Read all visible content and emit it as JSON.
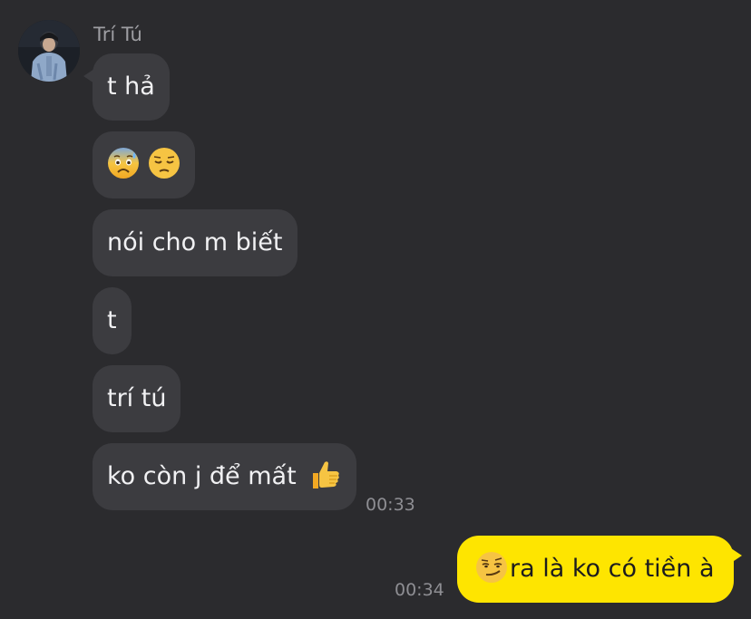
{
  "conversation": {
    "sender_name": "Trí Tú",
    "incoming": [
      {
        "text": "t hả"
      },
      {
        "text": "",
        "emojis": [
          "anxious-face-with-sweat-emoji",
          "pensive-face-emoji"
        ]
      },
      {
        "text": "nói cho m biết"
      },
      {
        "text": "t"
      },
      {
        "text": "trí tú"
      },
      {
        "text": "ko còn j để mất",
        "emojis": [
          "thumbs-up-emoji"
        ]
      }
    ],
    "incoming_time": "00:33",
    "outgoing": {
      "text": "ra là ko có tiền à",
      "emojis": [
        "smirking-face-emoji"
      ]
    },
    "outgoing_time": "00:34"
  },
  "colors": {
    "background": "#2b2b2e",
    "incoming_bubble": "#3c3c40",
    "outgoing_bubble": "#fee500",
    "timestamp": "#8e8e93"
  }
}
